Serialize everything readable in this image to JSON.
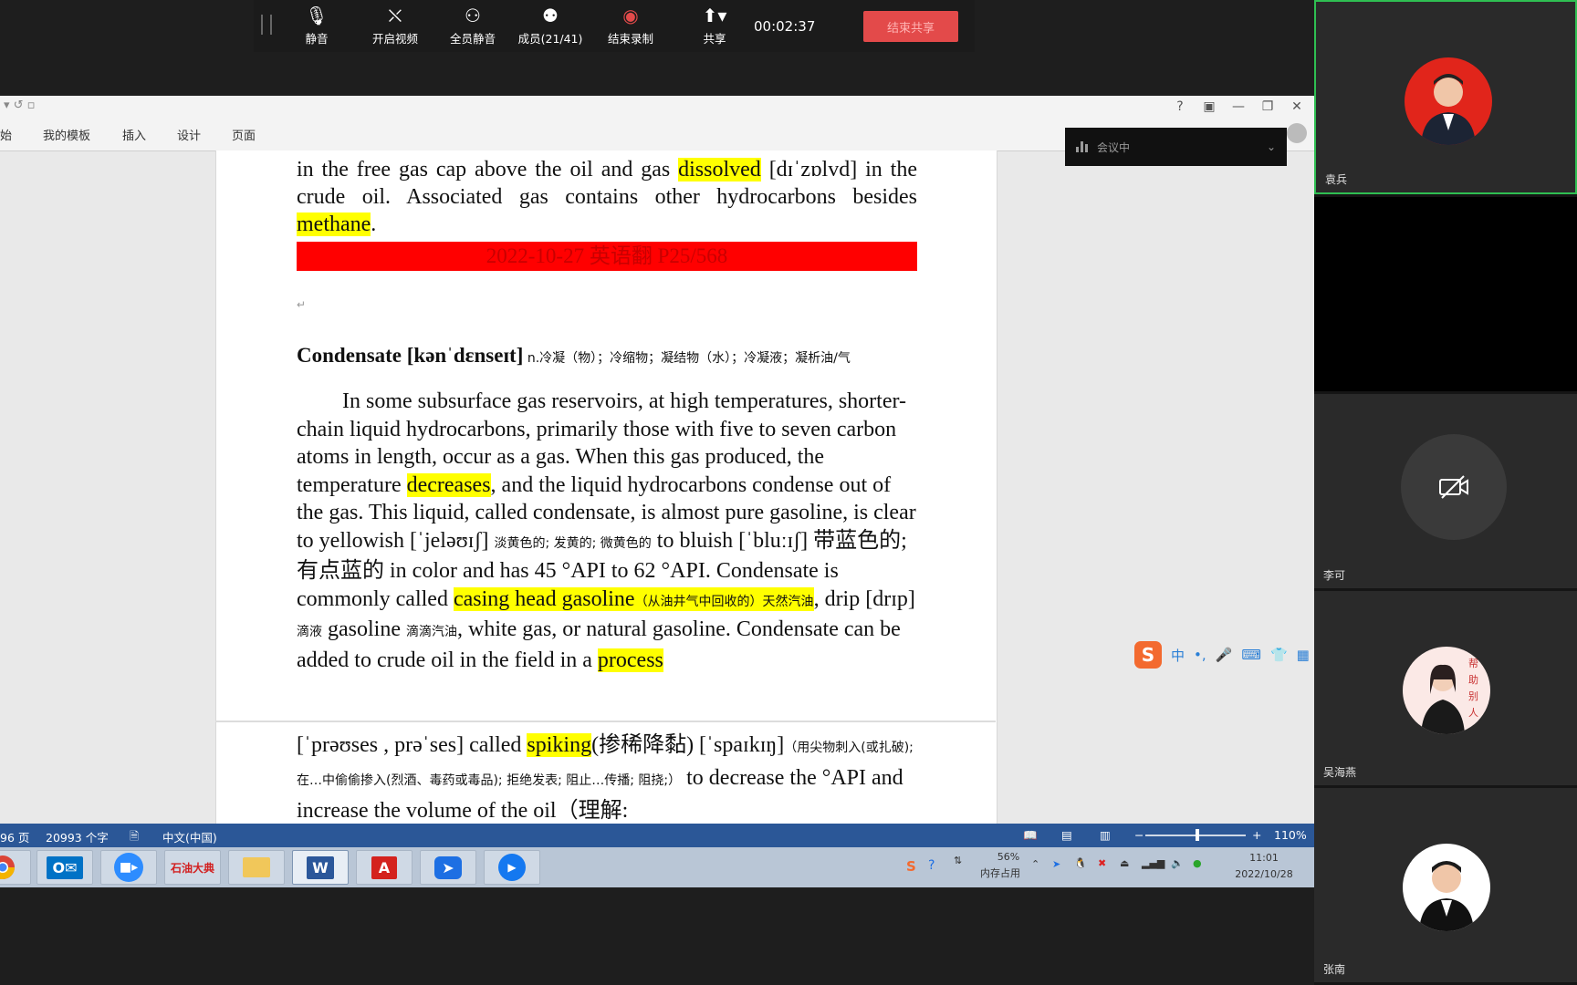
{
  "word": {
    "quick_access": "▾ ↺ ▫",
    "ribbon_tabs": [
      "始",
      "我的模板",
      "插入",
      "设计",
      "页面"
    ],
    "window_controls": [
      "?",
      "▣",
      "—",
      "❐",
      "✕"
    ]
  },
  "meeting_toolbar": {
    "buttons": [
      {
        "icon": "microphone-icon",
        "label": "静音"
      },
      {
        "icon": "camera-off-icon",
        "label": "开启视频"
      },
      {
        "icon": "mute-all-icon",
        "label": "全员静音"
      },
      {
        "icon": "members-icon",
        "label": "成员(21/41)"
      },
      {
        "icon": "record-icon",
        "label": "结束录制"
      },
      {
        "icon": "share-screen-icon",
        "label": "共享"
      }
    ],
    "timer": "00:02:37",
    "stop_share_label": "结束共享"
  },
  "meeting_status": {
    "text": "会议中"
  },
  "document": {
    "p1_a": "in the free gas cap above the oil and gas ",
    "p1_hl1": "dissolved",
    "p1_b": " [dɪˈzɒlvd] in the crude oil. Associated gas contains other hydrocarbons besides ",
    "p1_hl2": "methane",
    "p1_c": ".",
    "date_banner": "2022-10-27 英语翻 P25/568",
    "cond_term": "Condensate [kənˈdɛnseɪt]",
    "cond_gloss": " n.冷凝（物）；冷缩物；凝结物（水）；冷凝液；凝析油/气",
    "b1": "In some subsurface gas reservoirs, at high temperatures, shorter-chain liquid hydrocarbons, primarily those with five to seven carbon atoms in length, occur as a gas. When this gas produced, the temperature ",
    "b_hl1": "decreases",
    "b2": ", and the liquid hydrocarbons condense out of the gas. This liquid, called condensate, is almost pure gasoline, is clear to yellowish [ˈjeləʊɪʃ] ",
    "b_zh1": "淡黄色的; 发黄的; 微黄色的",
    "b3": " to bluish [ˈbluːɪʃ] 带蓝色的; 有点蓝的 in color and has 45 °API to 62 °API. Condensate is commonly called ",
    "b_hl2": "casing head gasoline",
    "b_zh2": "（从油井气中回收的）天然汽油",
    "b4": ", drip [drɪp] ",
    "b_zh3": "滴液",
    "b5": " gasoline ",
    "b_zh4": "滴滴汽油",
    "b6": ", white gas, or natural gasoline. Condensate can be added to crude oil in the field in a ",
    "b_hl3": "process",
    "n1": "[ˈprəʊses , prəˈses] called ",
    "n_hl1": "spiking",
    "n2": "(掺稀降黏) [ˈspaɪkɪŋ]",
    "n_zh1": "（用尖物刺入(或扎破); 在…中偷偷掺入(烈酒、毒药或毒品); 拒绝发表; 阻止…传播; 阻挠;）",
    "n3": " to decrease the °API and increase the volume of the oil（理解:"
  },
  "status_bar": {
    "page": "96 页",
    "words": "20993 个字",
    "language": "中文(中国)",
    "zoom": "110%"
  },
  "taskbar": {
    "apps": [
      "chrome",
      "outlook",
      "zoom",
      "石油大典",
      "explorer",
      "word",
      "acrobat",
      "feishu",
      "tencent-meeting"
    ],
    "app_label_petroleum": "石油大典",
    "mem_percent": "56%",
    "mem_label": "内存占用",
    "time": "11:01",
    "date": "2022/10/28"
  },
  "participants": [
    {
      "name": "袁兵",
      "active": true
    },
    {
      "name": "",
      "active": false
    },
    {
      "name": "李可",
      "active": false
    },
    {
      "name": "吴海燕",
      "active": false
    },
    {
      "name": "张南",
      "active": false
    }
  ],
  "colors": {
    "highlight": "#ffff00",
    "banner": "#ff0000",
    "status_bar": "#2b5797",
    "stop_share": "#e34a4a",
    "active_border": "#2fbf52"
  }
}
